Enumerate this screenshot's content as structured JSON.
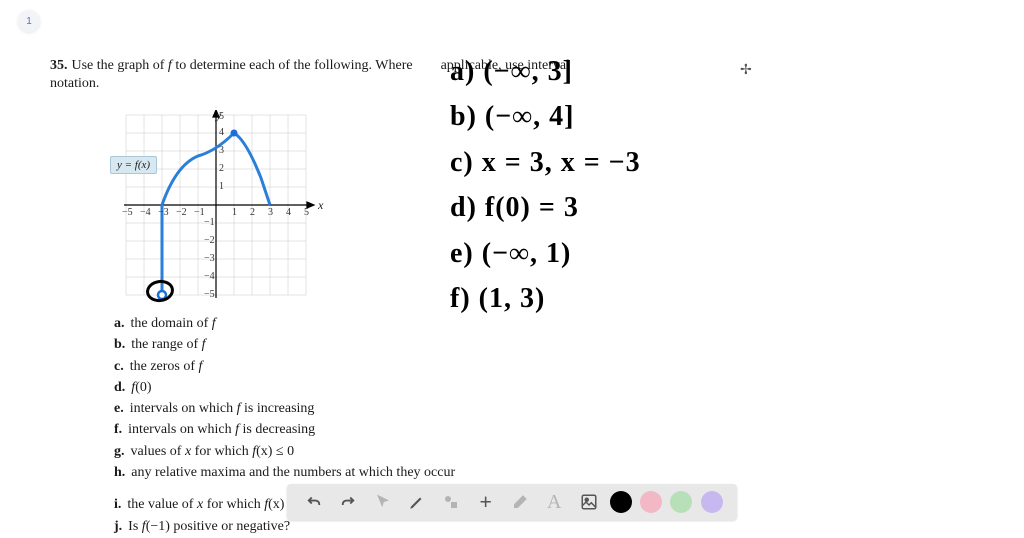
{
  "page_badge": "1",
  "problem": {
    "number": "35.",
    "text_line1": "Use the graph of ",
    "fn1": "f",
    "text_line1b": " to determine each of the following. Where",
    "text_line2": "applicable, use interval notation."
  },
  "graph": {
    "y_label": "y",
    "x_label": "x",
    "fn_label": "y = f(x)",
    "x_ticks": [
      "−5",
      "−4",
      "−3",
      "−2",
      "−1",
      "1",
      "2",
      "3",
      "4",
      "5"
    ],
    "y_ticks_pos": [
      "1",
      "2",
      "3",
      "4",
      "5"
    ],
    "y_ticks_neg": [
      "−1",
      "−2",
      "−3",
      "−4",
      "−5"
    ]
  },
  "parts": {
    "a": {
      "lbl": "a.",
      "txt": "the domain of ",
      "fn": "f"
    },
    "b": {
      "lbl": "b.",
      "txt": "the range of ",
      "fn": "f"
    },
    "c": {
      "lbl": "c.",
      "txt": "the zeros of ",
      "fn": "f"
    },
    "d": {
      "lbl": "d.",
      "fn": "f",
      "txt": "(0)"
    },
    "e": {
      "lbl": "e.",
      "txt": "intervals on which ",
      "fn": "f",
      "txt2": " is increasing"
    },
    "f": {
      "lbl": "f.",
      "txt": "intervals on which ",
      "fn": "f",
      "txt2": " is decreasing"
    },
    "g": {
      "lbl": "g.",
      "txt": "values of ",
      "var": "x",
      "txt2": " for which ",
      "fn": "f",
      "txt3": "(x) ≤ 0"
    },
    "h": {
      "lbl": "h.",
      "txt": "any relative maxima and the numbers at which they occur"
    },
    "i": {
      "lbl": "i.",
      "txt": "the value of ",
      "var": "x",
      "txt2": " for which ",
      "fn": "f",
      "txt3": "(x) = 4"
    },
    "j": {
      "lbl": "j.",
      "txt": "Is ",
      "fn": "f",
      "txt2": "(−1) positive or negative?"
    }
  },
  "answers": {
    "a": "a) (−∞, 3]",
    "b": "b) (−∞, 4]",
    "c": "c) x = 3, x = −3",
    "d": "d) f(0) = 3",
    "e": "e) (−∞, 1)",
    "f": "f) (1, 3)"
  },
  "toolbar": {
    "undo": "undo",
    "redo": "redo",
    "pointer": "pointer",
    "pencil": "pencil",
    "shapes": "shapes",
    "plus": "plus",
    "eraser": "eraser",
    "text": "text",
    "image": "image",
    "colors": {
      "black": "#000000",
      "pink": "#f2b8c6",
      "green": "#b8e0b8",
      "purple": "#c8b8f0"
    }
  },
  "chart_data": {
    "type": "line",
    "title": "y = f(x)",
    "xlabel": "x",
    "ylabel": "y",
    "xlim": [
      -5,
      5
    ],
    "ylim": [
      -5,
      5
    ],
    "series": [
      {
        "name": "f(x)",
        "points": [
          [
            -3,
            -5
          ],
          [
            -3,
            0
          ],
          [
            -2,
            2
          ],
          [
            -1,
            2.7
          ],
          [
            0,
            3
          ],
          [
            1,
            4
          ],
          [
            2,
            2.5
          ],
          [
            3,
            0
          ]
        ],
        "left_endpoint": "open_below",
        "right_endpoint": "closed"
      }
    ],
    "zeros": [
      -3,
      3
    ],
    "relative_max": {
      "x": 1,
      "y": 4
    }
  }
}
